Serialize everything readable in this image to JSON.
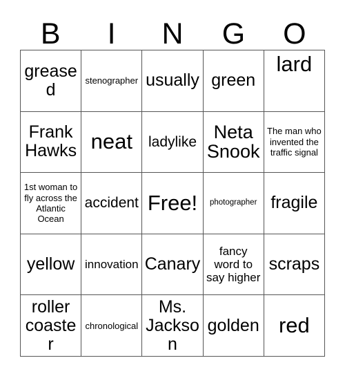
{
  "card": {
    "title": "BINGO",
    "header_letters": [
      "B",
      "I",
      "N",
      "G",
      "O"
    ],
    "colors": {
      "background": "#ffffff",
      "text": "#000000",
      "grid_line": "#555555"
    },
    "free_space": "Free!",
    "grid_size": "5x5",
    "rows": [
      [
        {
          "text": "greased",
          "size": "lg",
          "top": false
        },
        {
          "text": "stenographer",
          "size": "xs",
          "top": false
        },
        {
          "text": "usually",
          "size": "lg",
          "top": false
        },
        {
          "text": "green",
          "size": "lg",
          "top": false
        },
        {
          "text": "lard",
          "size": "xxl",
          "top": true
        }
      ],
      [
        {
          "text": "Frank Hawks",
          "size": "lg",
          "top": false
        },
        {
          "text": "neat",
          "size": "xxl",
          "top": false
        },
        {
          "text": "ladylike",
          "size": "md",
          "top": false
        },
        {
          "text": "Neta Snook",
          "size": "xl",
          "top": false
        },
        {
          "text": "The man who invented the traffic signal",
          "size": "xs",
          "top": false
        }
      ],
      [
        {
          "text": "1st woman to fly across the Atlantic Ocean",
          "size": "xs",
          "top": false
        },
        {
          "text": "accident",
          "size": "md",
          "top": false
        },
        {
          "text": "Free!",
          "size": "xxl",
          "top": false
        },
        {
          "text": "photographer",
          "size": "xxs",
          "top": false
        },
        {
          "text": "fragile",
          "size": "lg",
          "top": false
        }
      ],
      [
        {
          "text": "yellow",
          "size": "lg",
          "top": false
        },
        {
          "text": "innovation",
          "size": "sm",
          "top": false
        },
        {
          "text": "Canary",
          "size": "lg",
          "top": false
        },
        {
          "text": "fancy word to say higher",
          "size": "sm",
          "top": false
        },
        {
          "text": "scraps",
          "size": "lg",
          "top": false
        }
      ],
      [
        {
          "text": "roller coaster",
          "size": "lg",
          "top": false
        },
        {
          "text": "chronological",
          "size": "xs",
          "top": false
        },
        {
          "text": "Ms. Jackson",
          "size": "lg",
          "top": false
        },
        {
          "text": "golden",
          "size": "lg",
          "top": false
        },
        {
          "text": "red",
          "size": "xxl",
          "top": false
        }
      ]
    ]
  }
}
